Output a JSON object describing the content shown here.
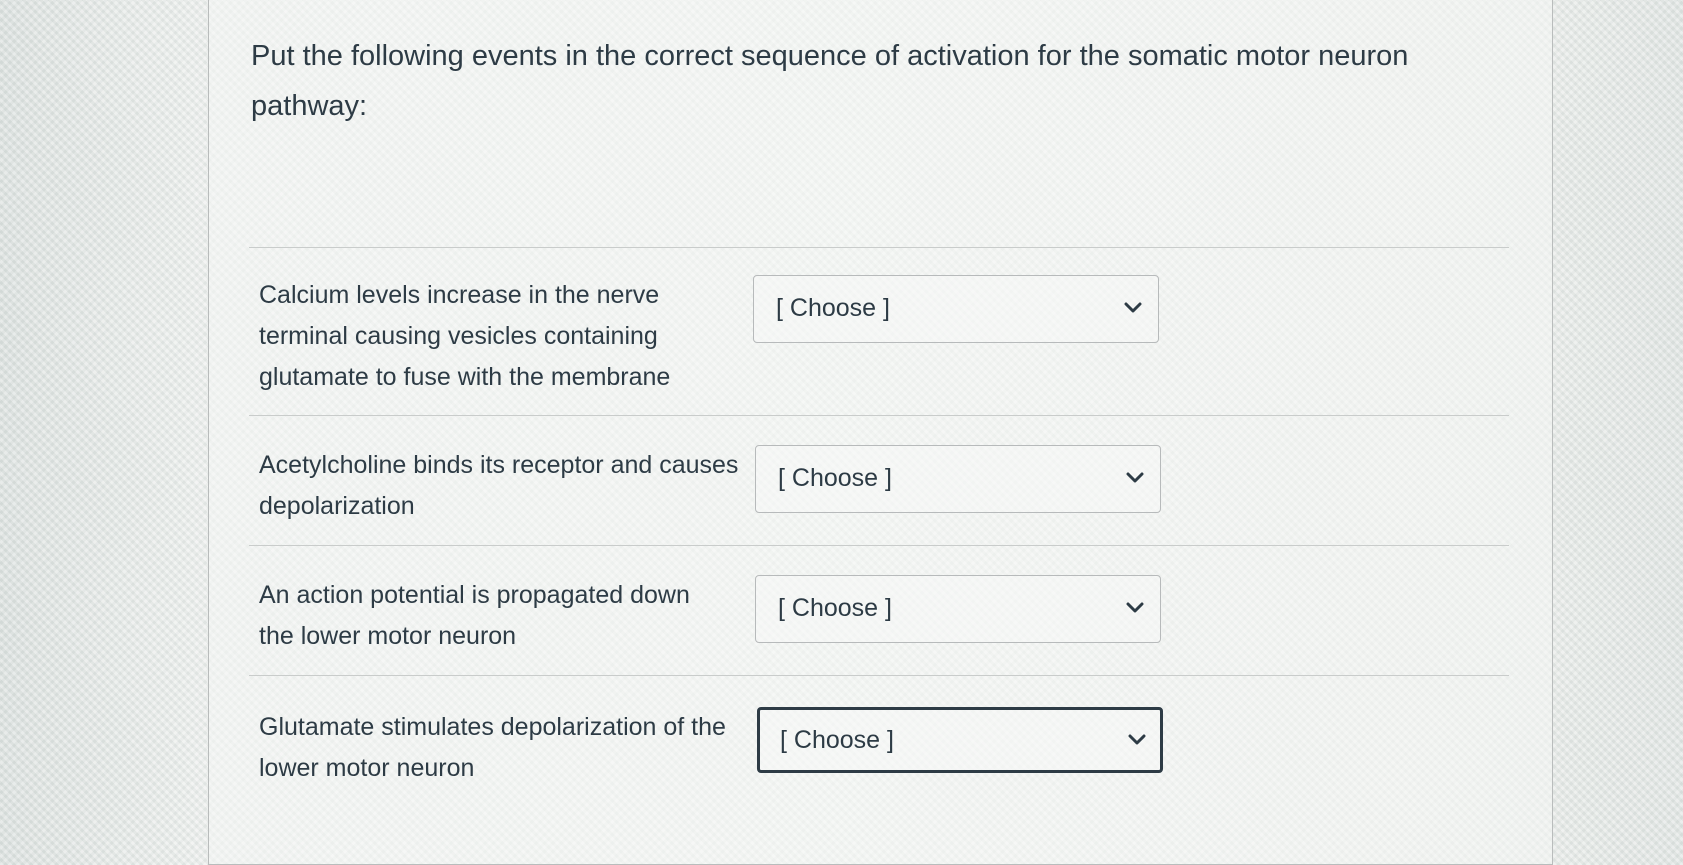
{
  "question": {
    "text": "Put the following events in the correct sequence of activation for the somatic motor neuron pathway:"
  },
  "matches": [
    {
      "prompt": "Calcium levels increase in the nerve terminal causing vesicles containing glutamate to fuse with the membrane",
      "selected": "[ Choose ]",
      "icon": "chevron-down-icon"
    },
    {
      "prompt": "Acetylcholine binds its receptor and causes depolarization",
      "selected": "[ Choose ]",
      "icon": "chevron-down-icon"
    },
    {
      "prompt": "An action potential is propagated down the lower motor neuron",
      "selected": "[ Choose ]",
      "icon": "chevron-down-icon"
    },
    {
      "prompt": "Glutamate stimulates depolarization of the lower motor neuron",
      "selected": "[ Choose ]",
      "icon": "chevron-down-icon"
    }
  ],
  "colors": {
    "text": "#2d3b45",
    "border": "#b7babb",
    "focus_border": "#2d3b45"
  }
}
